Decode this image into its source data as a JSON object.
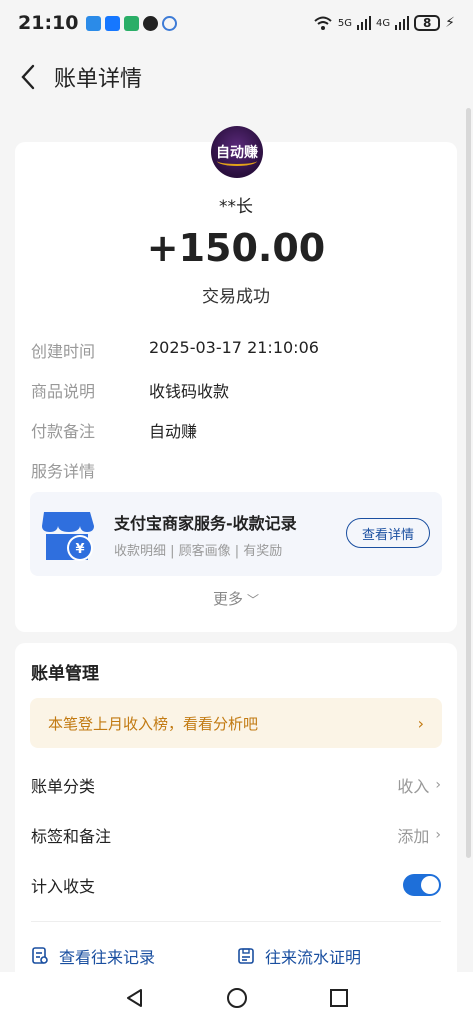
{
  "status_bar": {
    "time": "21:10",
    "battery": "8",
    "network_5g": "5G",
    "network_4g": "4G"
  },
  "header": {
    "title": "账单详情"
  },
  "transaction": {
    "payer": "**长",
    "avatar_text": "自动赚",
    "amount": "+150.00",
    "status": "交易成功"
  },
  "details": [
    {
      "label": "创建时间",
      "value": "2025-03-17 21:10:06"
    },
    {
      "label": "商品说明",
      "value": "收钱码收款"
    },
    {
      "label": "付款备注",
      "value": "自动赚"
    },
    {
      "label": "服务详情",
      "value": ""
    }
  ],
  "service": {
    "title": "支付宝商家服务-收款记录",
    "subtitle": "收款明细 | 顾客画像 | 有奖励",
    "button": "查看详情"
  },
  "more": {
    "label": "更多"
  },
  "management": {
    "title": "账单管理",
    "banner": "本笔登上月收入榜，看看分析吧",
    "rows": [
      {
        "label": "账单分类",
        "value": "收入"
      },
      {
        "label": "标签和备注",
        "value": "添加"
      },
      {
        "label": "计入收支",
        "toggle_on": true
      }
    ],
    "links": [
      {
        "label": "查看往来记录",
        "icon": "record-icon"
      },
      {
        "label": "往来流水证明",
        "icon": "certificate-icon"
      }
    ]
  },
  "colors": {
    "accent_blue": "#1a4fa0",
    "toggle_blue": "#1e6fd9",
    "banner_text": "#c27a12",
    "banner_bg": "#fbf4e6"
  }
}
